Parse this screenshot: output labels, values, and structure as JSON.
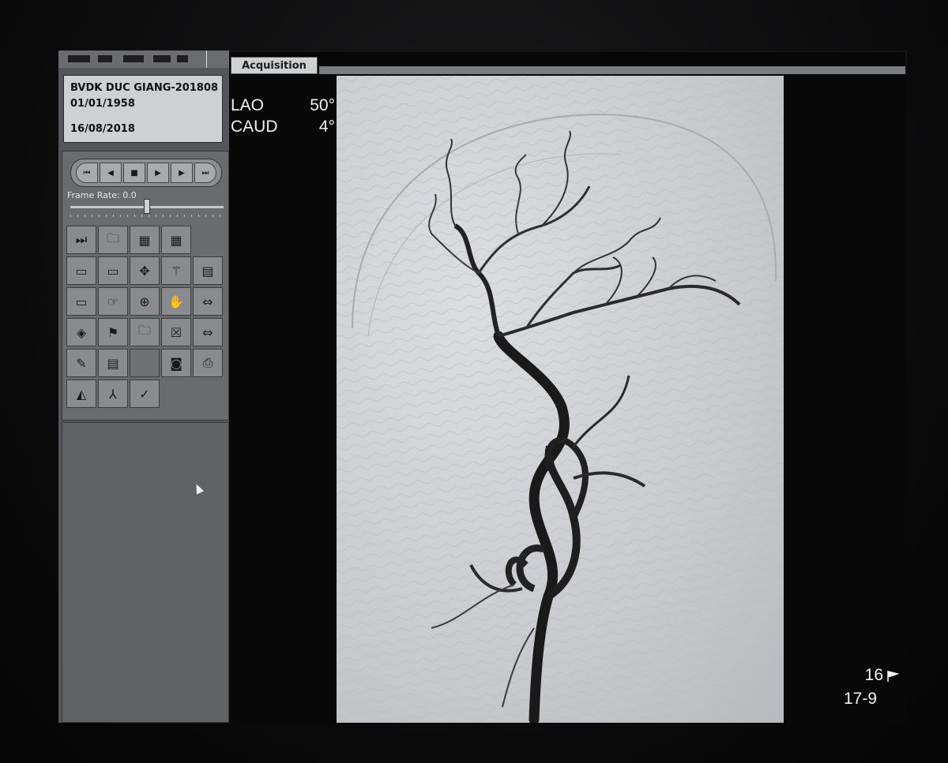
{
  "patient": {
    "name": "BVDK DUC GIANG-201808",
    "birth_date": "01/01/1958",
    "study_date": "16/08/2018"
  },
  "playback": {
    "frame_rate_label": "Frame Rate: 0.0",
    "slider_value": 0.5,
    "buttons": [
      "first-frame-icon",
      "prev-frame-icon",
      "stop-icon",
      "play-icon",
      "next-frame-icon",
      "last-frame-icon"
    ]
  },
  "tabs": {
    "active": "Acquisition"
  },
  "angles": {
    "row1_name": "LAO",
    "row1_value": "50°",
    "row2_name": "CAUD",
    "row2_value": "4°"
  },
  "frame": {
    "number": "16",
    "series": "17-9"
  },
  "tool_icons": [
    "skip-return-icon",
    "folder-return-icon",
    "frame-grid-icon",
    "calendar-grid-icon",
    "monitor-icon",
    "monitor-export-icon",
    "move-cross-icon",
    "skeleton-icon",
    "print-film-icon",
    "film-monitor-icon",
    "hand-pointer-icon",
    "zoom-image-icon",
    "hand-rotate-icon",
    "measure-icon",
    "eye-angle-icon",
    "flag-icon",
    "folder-icon",
    "close-box-icon",
    "measure-stack-icon",
    "edit-card-icon",
    "document-icon",
    "camera-icon",
    "printer-icon",
    "body-measure-icon",
    "vessel-branch-icon",
    "curve-tool-icon"
  ],
  "colors": {
    "panel": "#555659",
    "image_background": "#c9cacd",
    "vessel": "#1a1a1a",
    "overlay_text": "#f2f2f2"
  }
}
